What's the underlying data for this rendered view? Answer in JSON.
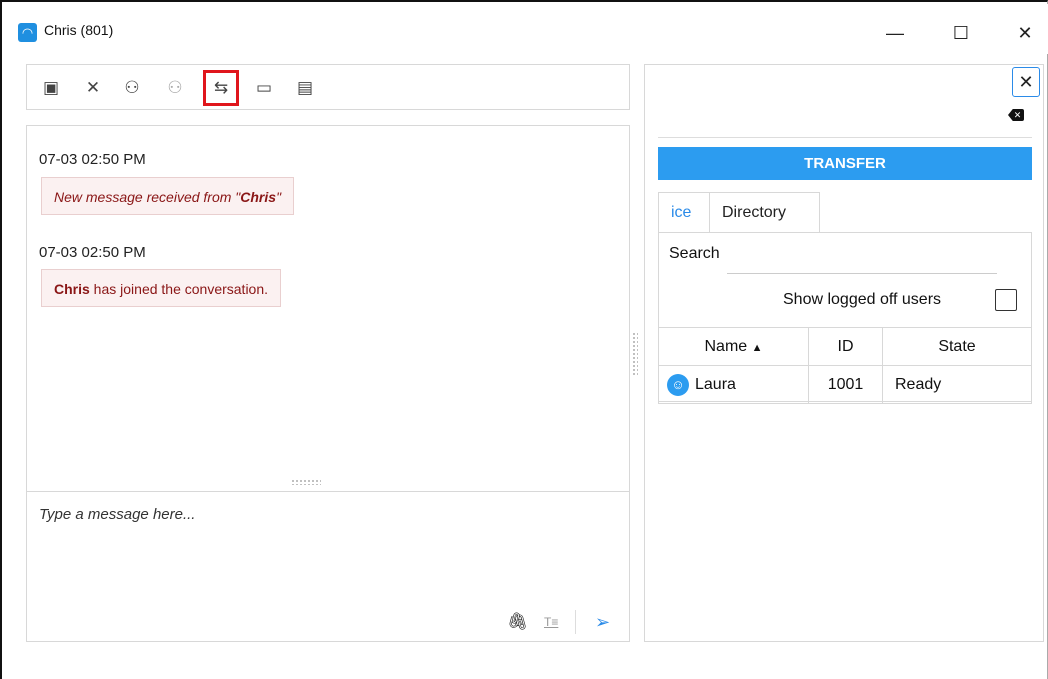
{
  "window": {
    "title": "Chris (801)",
    "controls": {
      "minimize": "—",
      "maximize": "☐",
      "close": "✕"
    }
  },
  "toolbar": {
    "items": [
      {
        "name": "contact-card-icon",
        "glyph": "▣"
      },
      {
        "name": "end-chat-icon",
        "glyph": "✕"
      },
      {
        "name": "conference-icon",
        "glyph": "⚇"
      },
      {
        "name": "remove-participant-icon",
        "glyph": "⚇"
      },
      {
        "name": "transfer-icon",
        "glyph": "⇆"
      },
      {
        "name": "briefcase-icon",
        "glyph": "▭"
      },
      {
        "name": "transcript-icon",
        "glyph": "▤"
      }
    ]
  },
  "messages": [
    {
      "timestamp": "07-03 02:50 PM",
      "prefix": "New message received from \"",
      "bold": "Chris",
      "suffix": "\""
    },
    {
      "timestamp": "07-03 02:50 PM",
      "bold": "Chris",
      "suffix": " has joined the conversation."
    }
  ],
  "composer": {
    "placeholder": "Type a message here...",
    "attach_glyph": "🖇",
    "format_glyph": "T≡",
    "send_glyph": "➢"
  },
  "transfer_panel": {
    "close_glyph": "✕",
    "header": "TRANSFER",
    "tabs": [
      "ice",
      "Directory"
    ],
    "active_tab": "ice",
    "search_label": "Search",
    "show_logged_off_label": "Show logged off users",
    "show_logged_off_checked": false,
    "columns": [
      "Name",
      "ID",
      "State"
    ],
    "sort_glyph": "▲",
    "rows": [
      {
        "name": "Laura",
        "id": "1001",
        "state": "Ready"
      }
    ]
  },
  "colors": {
    "accent": "#2c9cf0",
    "message_text": "#8a1616",
    "message_bg": "#fbf1f1",
    "highlight": "#e0161c"
  }
}
